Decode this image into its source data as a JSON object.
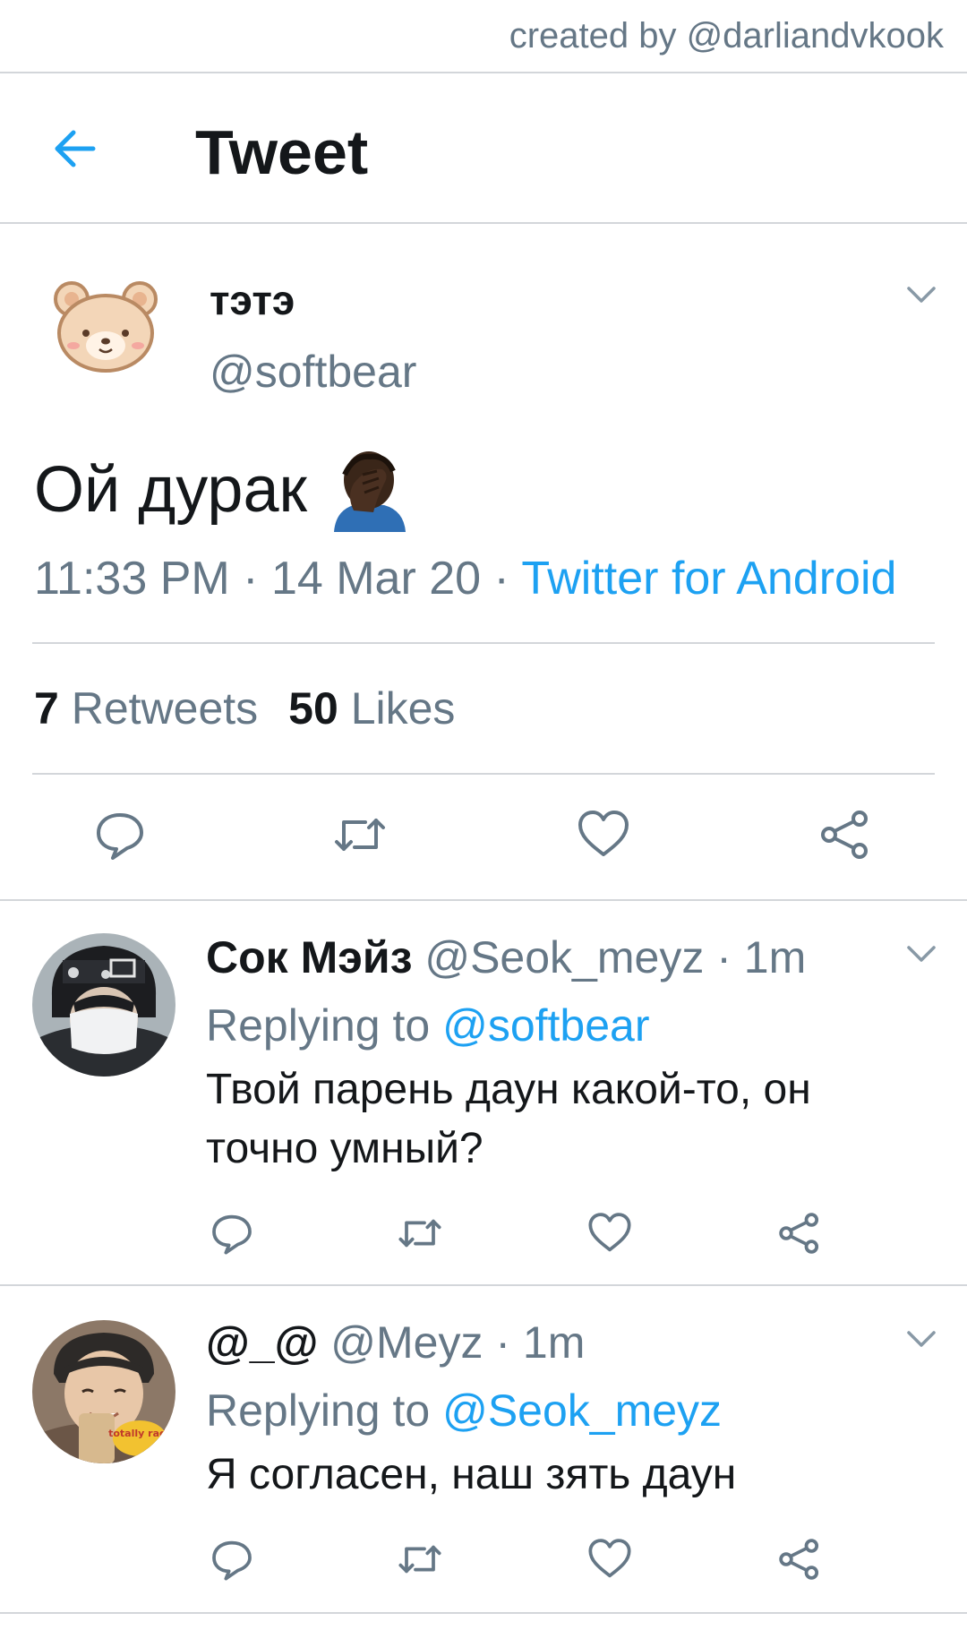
{
  "credit": "created by @darliandvkook",
  "header": {
    "title": "Tweet",
    "back_icon": "arrow-left-icon"
  },
  "tweet": {
    "author_name": "тэтэ",
    "author_handle": "@softbear",
    "text": "Ой дурак",
    "emoji": "facepalm-emoji",
    "time": "11:33 PM",
    "date": "14 Mar 20",
    "separator": " · ",
    "source": "Twitter for Android",
    "retweets_count": "7",
    "retweets_label": "Retweets",
    "likes_count": "50",
    "likes_label": "Likes"
  },
  "replies": [
    {
      "name": "Сок Мэйз",
      "handle": "@Seok_meyz",
      "time": "· 1m",
      "replying_prefix": "Replying to",
      "replying_to": "@softbear",
      "text": "Твой парень даун какой-то, он точно умный?"
    },
    {
      "name": "@_@",
      "handle": "@Meyz",
      "time": "· 1m",
      "replying_prefix": "Replying to",
      "replying_to": "@Seok_meyz",
      "text": "Я согласен, наш зять даун",
      "avatar_sticker": "totally rad!"
    }
  ],
  "colors": {
    "accent": "#1da1f2",
    "secondary": "#657786",
    "text": "#14171a",
    "divider": "#d3d6da"
  }
}
